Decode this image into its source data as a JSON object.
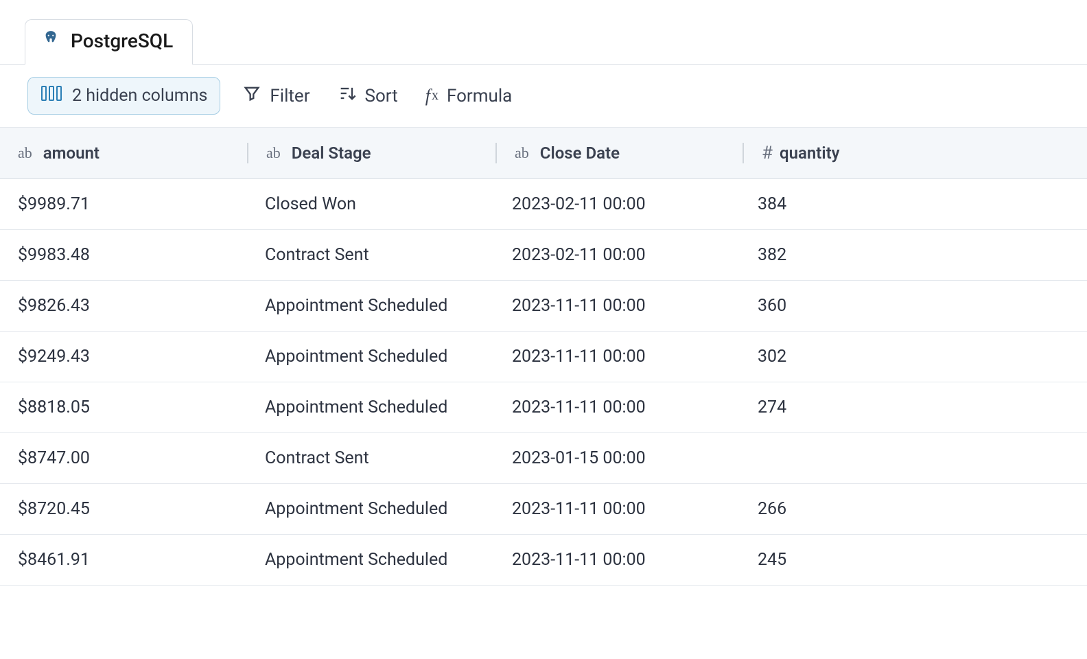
{
  "tab": {
    "label": "PostgreSQL"
  },
  "toolbar": {
    "hidden_columns_label": "2 hidden columns",
    "filter_label": "Filter",
    "sort_label": "Sort",
    "formula_label": "Formula"
  },
  "columns": {
    "amount": {
      "label": "amount",
      "type": "text"
    },
    "stage": {
      "label": "Deal Stage",
      "type": "text"
    },
    "date": {
      "label": "Close Date",
      "type": "text"
    },
    "quantity": {
      "label": "quantity",
      "type": "number"
    }
  },
  "rows": [
    {
      "amount": "$9989.71",
      "stage": "Closed Won",
      "date": "2023-02-11 00:00",
      "quantity": "384"
    },
    {
      "amount": "$9983.48",
      "stage": "Contract Sent",
      "date": "2023-02-11 00:00",
      "quantity": "382"
    },
    {
      "amount": "$9826.43",
      "stage": "Appointment Scheduled",
      "date": "2023-11-11 00:00",
      "quantity": "360"
    },
    {
      "amount": "$9249.43",
      "stage": "Appointment Scheduled",
      "date": "2023-11-11 00:00",
      "quantity": "302"
    },
    {
      "amount": "$8818.05",
      "stage": "Appointment Scheduled",
      "date": "2023-11-11 00:00",
      "quantity": "274"
    },
    {
      "amount": "$8747.00",
      "stage": "Contract Sent",
      "date": "2023-01-15 00:00",
      "quantity": ""
    },
    {
      "amount": "$8720.45",
      "stage": "Appointment Scheduled",
      "date": "2023-11-11 00:00",
      "quantity": "266"
    },
    {
      "amount": "$8461.91",
      "stage": "Appointment Scheduled",
      "date": "2023-11-11 00:00",
      "quantity": "245"
    }
  ]
}
